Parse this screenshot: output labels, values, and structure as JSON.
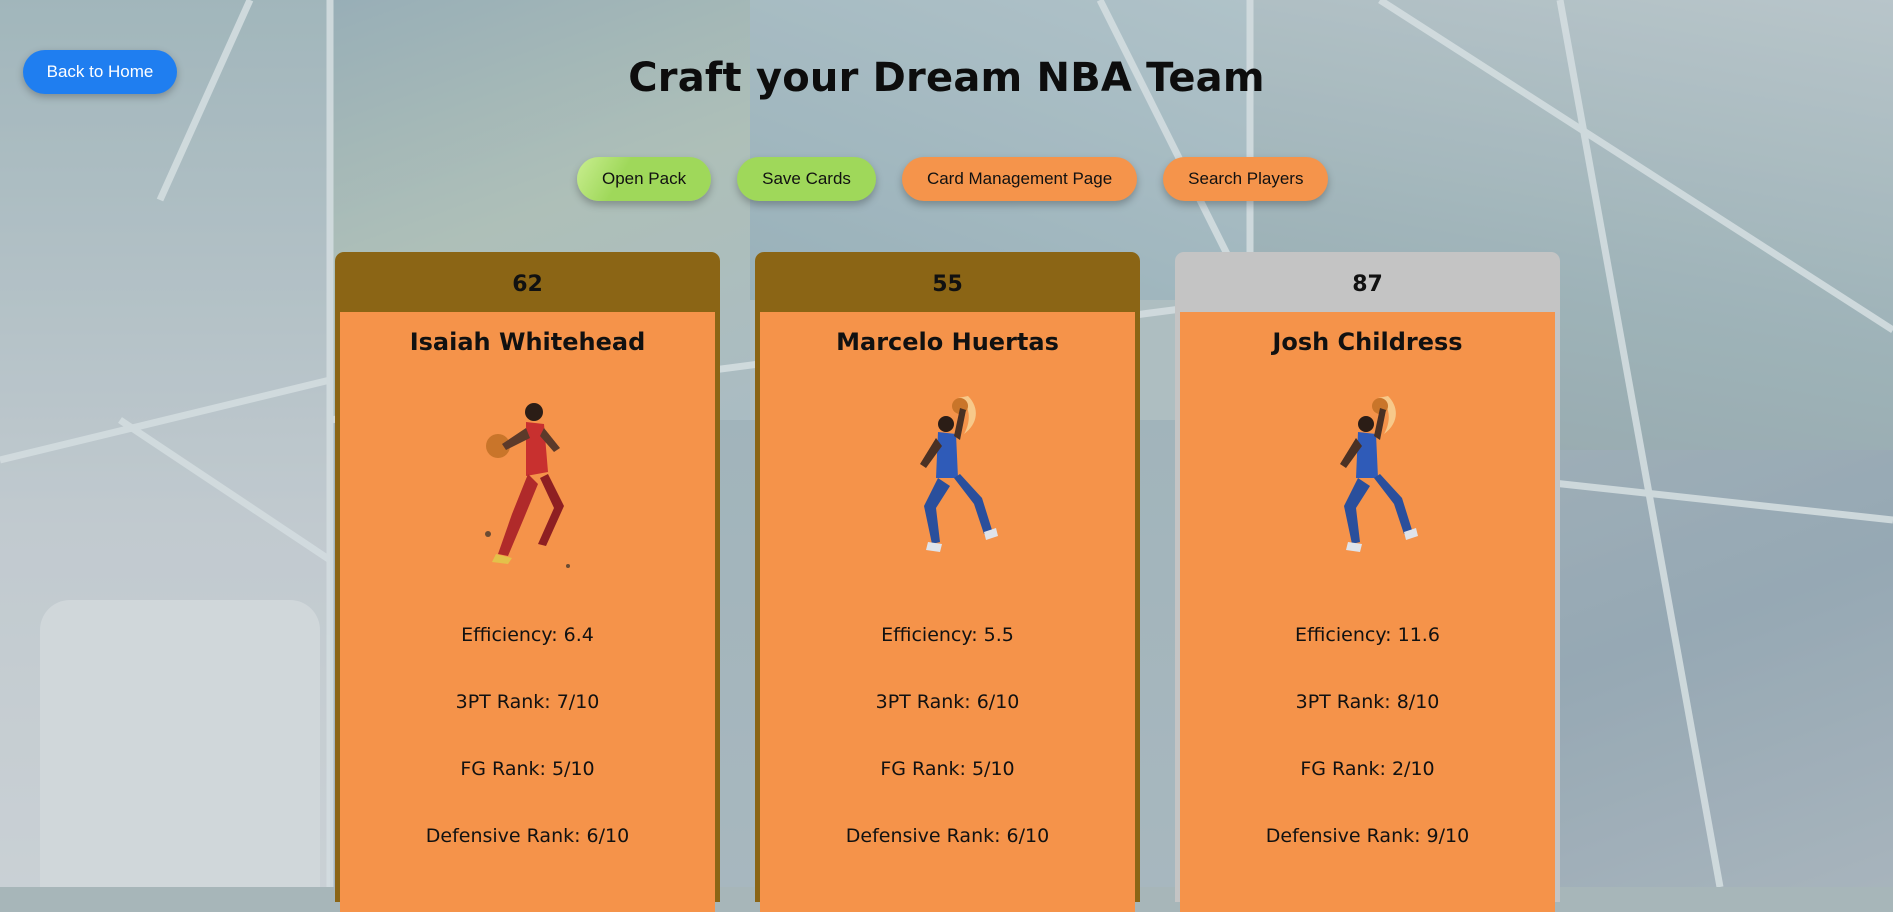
{
  "page": {
    "title": "Craft your Dream NBA Team"
  },
  "nav": {
    "back_label": "Back to Home"
  },
  "actions": {
    "open_pack": "Open Pack",
    "save_cards": "Save Cards",
    "card_management": "Card Management Page",
    "search_players": "Search Players"
  },
  "colors": {
    "home_button": "#1f7ef0",
    "green_button": "#9fd85a",
    "orange_button": "#f5944b",
    "card_body": "#f5934a",
    "bronze_tier": "#8b6515",
    "silver_tier": "#c4c4c4"
  },
  "cards": [
    {
      "rating": "62",
      "name": "Isaiah Whitehead",
      "tier": "bronze",
      "photo": "dunk-red-jersey",
      "efficiency": "Efficiency: 6.4",
      "three_pt": "3PT Rank: 7/10",
      "fg": "FG Rank: 5/10",
      "defense": "Defensive Rank: 6/10"
    },
    {
      "rating": "55",
      "name": "Marcelo Huertas",
      "tier": "bronze",
      "photo": "dunk-blue-jersey",
      "efficiency": "Efficiency: 5.5",
      "three_pt": "3PT Rank: 6/10",
      "fg": "FG Rank: 5/10",
      "defense": "Defensive Rank: 6/10"
    },
    {
      "rating": "87",
      "name": "Josh Childress",
      "tier": "silver",
      "photo": "dunk-blue-jersey",
      "efficiency": "Efficiency: 11.6",
      "three_pt": "3PT Rank: 8/10",
      "fg": "FG Rank: 2/10",
      "defense": "Defensive Rank: 9/10"
    }
  ]
}
